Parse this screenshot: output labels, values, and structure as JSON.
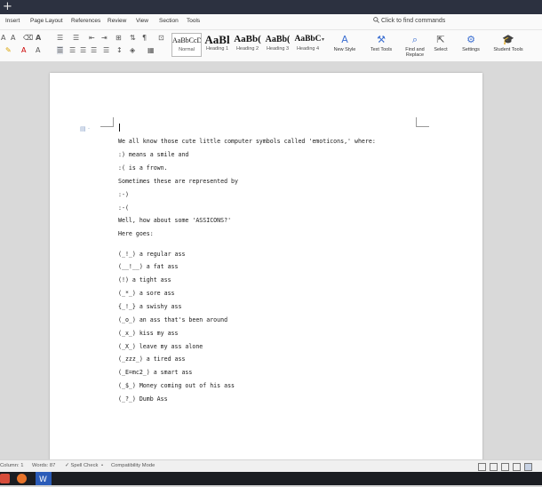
{
  "menu": {
    "items": [
      "Insert",
      "Page Layout",
      "References",
      "Review",
      "View",
      "Section",
      "Tools"
    ],
    "command_search": "Click to find commands"
  },
  "ribbon": {
    "styles": [
      {
        "preview": "AaBbCcDd",
        "name": "Normal"
      },
      {
        "preview": "AaBl",
        "name": "Heading 1"
      },
      {
        "preview": "AaBb(",
        "name": "Heading 2"
      },
      {
        "preview": "AaBb(",
        "name": "Heading 3"
      },
      {
        "preview": "AaBbC",
        "name": "Heading 4"
      }
    ],
    "new_style": "New Style",
    "text_tools": "Text Tools",
    "find_replace_line1": "Find and",
    "find_replace_line2": "Replace",
    "select": "Select",
    "settings": "Settings",
    "student_tools": "Student Tools"
  },
  "document": {
    "lines": [
      "We all know those cute little computer symbols called 'emoticons,' where:",
      ":) means a smile and",
      ":( is a frown.",
      "Sometimes these are represented by",
      ":-)",
      ":-(",
      "Well, how about some 'ASSICONS?'",
      "Here goes:",
      "(_!_) a regular ass",
      "(__!__) a fat ass",
      "(!) a tight ass",
      "(_*_) a sore ass",
      "{_!_} a swishy ass",
      "(_o_) an ass that's been around",
      "(_x_) kiss my ass",
      "(_X_) leave my ass alone",
      "(_zzz_) a tired ass",
      "(_E=mc2_) a smart ass",
      "(_$_) Money coming out of his ass",
      "(_?_) Dumb Ass"
    ]
  },
  "status": {
    "column": "Column: 1",
    "words": "Words: 87",
    "spell_check": "Spell Check",
    "compat": "Compatibility Mode"
  },
  "colors": {
    "titlebar": "#2c3140",
    "accent": "#3c6fd1",
    "taskbar": "#1b1d22"
  }
}
